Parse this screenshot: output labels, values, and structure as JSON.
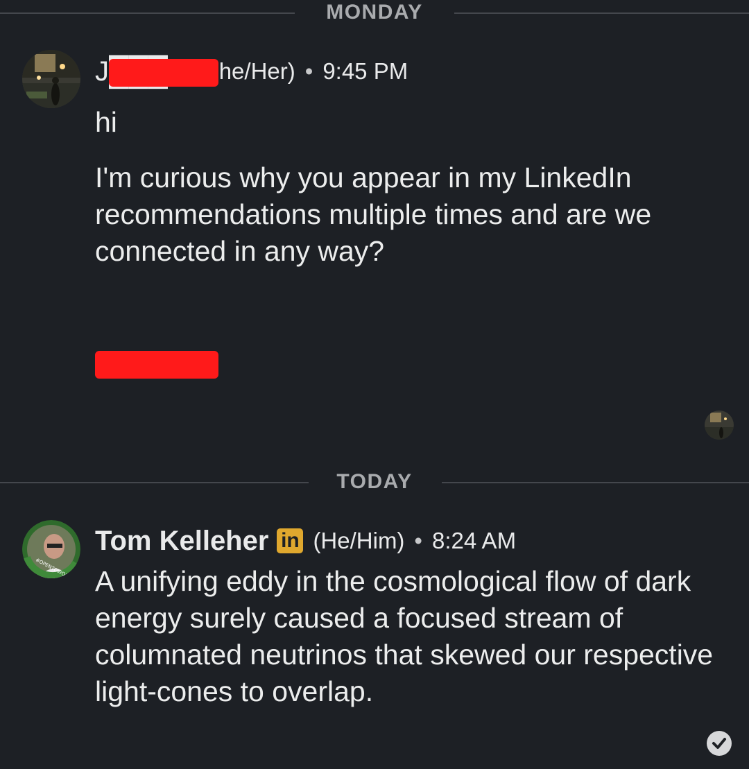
{
  "dividers": {
    "monday": "MONDAY",
    "today": "TODAY"
  },
  "messages": [
    {
      "sender_visible": "J███K",
      "pronouns": "(She/Her)",
      "separator": "•",
      "time": "9:45 PM",
      "lines": [
        "hi",
        "I'm curious why you appear in my LinkedIn recommendations multiple times and are we connected in any way?"
      ],
      "signature_redacted": true
    },
    {
      "sender": "Tom Kelleher",
      "badge": "in",
      "pronouns": "(He/Him)",
      "separator": "•",
      "time": "8:24 AM",
      "avatar_ring_text": "#OPENTOWORK",
      "lines": [
        "A unifying eddy in the cosmological flow of dark energy surely caused a focused stream of columnated neutrinos that skewed our respective light-cones to overlap."
      ]
    }
  ],
  "colors": {
    "background": "#1d2025",
    "text": "#e9eaeb",
    "divider": "#44474d",
    "redaction": "#ff1a1a",
    "linkedin_badge": "#e0a82e",
    "open_to_work_ring": "#3f8a3a"
  }
}
